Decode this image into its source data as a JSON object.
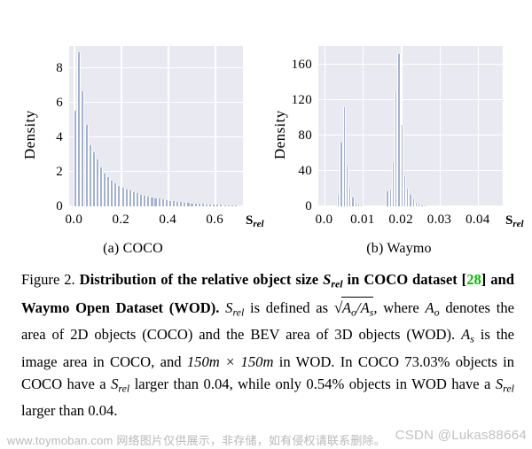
{
  "figure": {
    "panels": [
      {
        "id": "coco",
        "subcaption": "(a) COCO",
        "ylabel": "Density",
        "xsymbol": "S",
        "xsymbol_sub": "rel"
      },
      {
        "id": "waymo",
        "subcaption": "(b) Waymo",
        "ylabel": "Density",
        "xsymbol": "S",
        "xsymbol_sub": "rel"
      }
    ]
  },
  "chart_data": [
    {
      "type": "bar",
      "title": "(a) COCO",
      "xlabel": "S_rel",
      "ylabel": "Density",
      "xlim": [
        -0.02,
        0.72
      ],
      "ylim": [
        0,
        9.3
      ],
      "xticks": [
        "0.0",
        "0.2",
        "0.4",
        "0.6"
      ],
      "xtick_values": [
        0.0,
        0.2,
        0.4,
        0.6
      ],
      "yticks": [
        "0",
        "2",
        "4",
        "6",
        "8"
      ],
      "ytick_values": [
        0,
        2,
        4,
        6,
        8
      ],
      "grid": true,
      "bin_width": 0.0155,
      "x": [
        0.007,
        0.023,
        0.038,
        0.054,
        0.069,
        0.085,
        0.1,
        0.116,
        0.131,
        0.147,
        0.162,
        0.178,
        0.193,
        0.209,
        0.224,
        0.24,
        0.255,
        0.271,
        0.286,
        0.302,
        0.317,
        0.333,
        0.348,
        0.364,
        0.379,
        0.395,
        0.41,
        0.426,
        0.441,
        0.457,
        0.472,
        0.488,
        0.503,
        0.519,
        0.534,
        0.55,
        0.565,
        0.581,
        0.596,
        0.612,
        0.627,
        0.643,
        0.658,
        0.674,
        0.689
      ],
      "values": [
        5.55,
        8.95,
        6.7,
        4.75,
        3.55,
        3.15,
        2.7,
        2.25,
        1.9,
        1.7,
        1.5,
        1.32,
        1.18,
        1.08,
        0.98,
        0.9,
        0.82,
        0.75,
        0.68,
        0.62,
        0.57,
        0.53,
        0.48,
        0.44,
        0.4,
        0.36,
        0.33,
        0.3,
        0.27,
        0.25,
        0.22,
        0.2,
        0.18,
        0.16,
        0.15,
        0.13,
        0.12,
        0.11,
        0.1,
        0.09,
        0.08,
        0.07,
        0.06,
        0.05,
        0.04
      ]
    },
    {
      "type": "bar",
      "title": "(b) Waymo",
      "xlabel": "S_rel",
      "ylabel": "Density",
      "xlim": [
        -0.0015,
        0.0465
      ],
      "ylim": [
        0,
        181
      ],
      "xticks": [
        "0.0",
        "0.01",
        "0.02",
        "0.03",
        "0.04"
      ],
      "xtick_values": [
        0.0,
        0.01,
        0.02,
        0.03,
        0.04
      ],
      "yticks": [
        "0",
        "40",
        "80",
        "120",
        "160"
      ],
      "ytick_values": [
        0,
        40,
        80,
        120,
        160
      ],
      "grid": true,
      "bin_width": 0.00075,
      "x": [
        0.00375,
        0.0045,
        0.00525,
        0.006,
        0.00675,
        0.0075,
        0.00825,
        0.009,
        0.00975,
        0.0105,
        0.0165,
        0.01725,
        0.018,
        0.01875,
        0.0195,
        0.02025,
        0.021,
        0.02175,
        0.0225,
        0.02325,
        0.024,
        0.02475,
        0.0255,
        0.02625,
        0.027,
        0.02775,
        0.0285,
        0.02925,
        0.03
      ],
      "values": [
        13,
        72,
        112,
        46,
        21,
        10,
        4,
        2,
        1,
        0,
        17,
        19,
        50,
        129,
        172,
        92,
        34,
        20,
        13,
        8,
        4,
        3,
        1,
        1,
        0,
        0,
        0,
        0,
        0
      ]
    }
  ],
  "caption": {
    "prefix": "Figure 2. ",
    "bold_1": "Distribution of the relative object size ",
    "sym_S": "S",
    "sym_rel": "rel",
    "bold_2": " in COCO dataset [",
    "citation": "28",
    "bold_3": "] and Waymo Open Dataset (WOD).",
    "text_1": " is defined as ",
    "sqrt_num": "A",
    "sqrt_num_sub": "o",
    "sqrt_den": "A",
    "sqrt_den_sub": "s",
    "text_2": ", where ",
    "text_3": " denotes the area of 2D objects (COCO) and the BEV area of 3D objects (WOD). ",
    "text_4": " is the image area in COCO, and ",
    "math_150": "150m × 150m",
    "text_5": " in WOD. In COCO 73.03% objects in COCO have a ",
    "text_6": " larger than 0.04, while only 0.54% objects in WOD have a ",
    "text_7": " larger than 0.04."
  },
  "watermarks": {
    "left": "www.toymoban.com 网络图片仅供展示，非存储，如有侵权请联系删除。",
    "right": "CSDN @Lukas88664"
  },
  "colors": {
    "bar": "#a3b2d2",
    "plot_bg": "#e9e9f2",
    "grid": "#ffffff",
    "citation": "#00c000",
    "watermark": "#bdbdbd"
  }
}
